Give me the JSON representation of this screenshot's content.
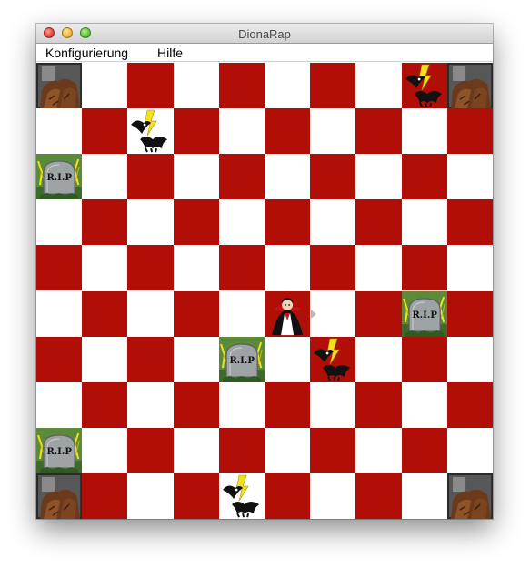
{
  "window": {
    "title": "DionaRap"
  },
  "menu": {
    "items": [
      {
        "label": "Konfigurierung"
      },
      {
        "label": "Hilfe"
      }
    ]
  },
  "board": {
    "rows": 10,
    "cols": 10,
    "colors": {
      "dark": "#b10e07",
      "light": "#ffffff"
    },
    "cells": [
      {
        "row": 0,
        "col": 0,
        "type": "obstacle",
        "icon": "stone-wall-icon"
      },
      {
        "row": 0,
        "col": 8,
        "type": "opponent",
        "icon": "bat-opponent-icon"
      },
      {
        "row": 0,
        "col": 9,
        "type": "obstacle",
        "icon": "stone-wall-icon"
      },
      {
        "row": 1,
        "col": 2,
        "type": "opponent",
        "icon": "bat-opponent-icon"
      },
      {
        "row": 2,
        "col": 0,
        "type": "grave",
        "icon": "rip-gravestone-icon",
        "text": "R.I.P"
      },
      {
        "row": 5,
        "col": 5,
        "type": "player",
        "icon": "vampire-player-icon",
        "facing": "right"
      },
      {
        "row": 5,
        "col": 8,
        "type": "grave",
        "icon": "rip-gravestone-icon",
        "text": "R.I.P"
      },
      {
        "row": 6,
        "col": 4,
        "type": "grave",
        "icon": "rip-gravestone-icon",
        "text": "R.I.P"
      },
      {
        "row": 6,
        "col": 6,
        "type": "opponent",
        "icon": "bat-opponent-icon"
      },
      {
        "row": 8,
        "col": 0,
        "type": "grave",
        "icon": "rip-gravestone-icon",
        "text": "R.I.P"
      },
      {
        "row": 9,
        "col": 0,
        "type": "obstacle",
        "icon": "stone-wall-icon"
      },
      {
        "row": 9,
        "col": 4,
        "type": "opponent",
        "icon": "bat-opponent-icon"
      },
      {
        "row": 9,
        "col": 9,
        "type": "obstacle",
        "icon": "stone-wall-icon"
      }
    ]
  }
}
